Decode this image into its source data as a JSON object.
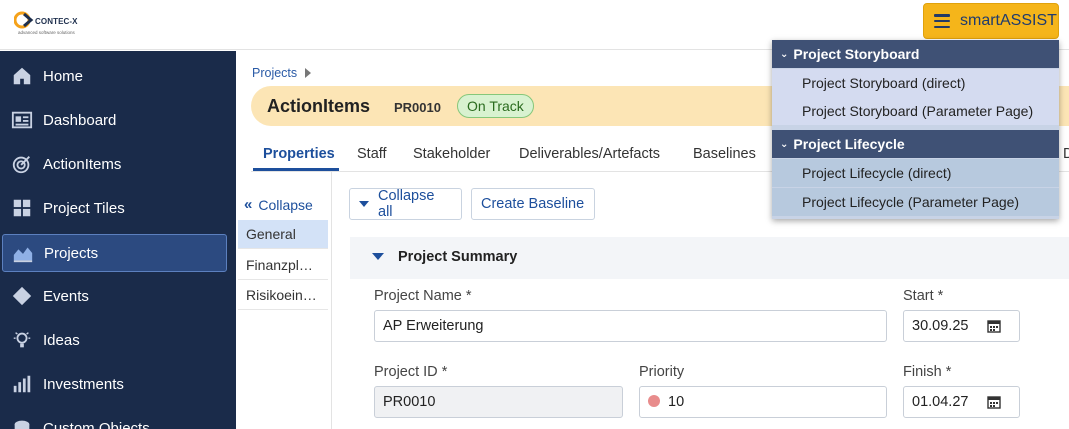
{
  "header": {
    "logo_text": "CONTEC-X",
    "logo_tagline": "advanced software solutions",
    "assistant_button": "smartASSIST"
  },
  "sidebar": {
    "items": [
      {
        "label": "Home",
        "icon": "home-icon"
      },
      {
        "label": "Dashboard",
        "icon": "dashboard-icon"
      },
      {
        "label": "ActionItems",
        "icon": "target-icon"
      },
      {
        "label": "Project Tiles",
        "icon": "tiles-icon"
      },
      {
        "label": "Projects",
        "icon": "chart-area-icon",
        "active": true
      },
      {
        "label": "Events",
        "icon": "diamond-icon"
      },
      {
        "label": "Ideas",
        "icon": "lightbulb-icon"
      },
      {
        "label": "Investments",
        "icon": "bar-chart-icon"
      },
      {
        "label": "Custom Objects",
        "icon": "custom-objects-icon"
      }
    ]
  },
  "breadcrumb": {
    "label": "Projects"
  },
  "project": {
    "title": "ActionItems",
    "code": "PR0010",
    "status": "On Track"
  },
  "tabs": [
    {
      "label": "Properties",
      "active": true
    },
    {
      "label": "Staff"
    },
    {
      "label": "Stakeholder"
    },
    {
      "label": "Deliverables/Artefacts"
    },
    {
      "label": "Baselines"
    },
    {
      "label": "D"
    }
  ],
  "subnav": {
    "collapse_label": "Collapse",
    "items": [
      {
        "label": "General",
        "active": true
      },
      {
        "label": "Finanzpl…"
      },
      {
        "label": "Risikoein…"
      }
    ]
  },
  "toolbar": {
    "collapse_all": "Collapse all",
    "create_baseline": "Create Baseline"
  },
  "section": {
    "title": "Project Summary",
    "fields": {
      "project_name": {
        "label": "Project Name",
        "required": "*",
        "value": "AP Erweiterung"
      },
      "start": {
        "label": "Start",
        "required": "*",
        "value": "30.09.25"
      },
      "project_id": {
        "label": "Project ID",
        "required": "*",
        "value": "PR0010"
      },
      "priority": {
        "label": "Priority",
        "value": "10"
      },
      "finish": {
        "label": "Finish",
        "required": "*",
        "value": "01.04.27"
      }
    }
  },
  "dropdown": {
    "groups": [
      {
        "title": "Project Storyboard",
        "items": [
          "Project Storyboard (direct)",
          "Project Storyboard (Parameter Page)"
        ]
      },
      {
        "title": "Project Lifecycle",
        "items": [
          "Project Lifecycle (direct)",
          "Project Lifecycle (Parameter Page)"
        ]
      }
    ]
  },
  "colors": {
    "sidebar_bg": "#1a2b4a",
    "accent": "#1d4f9c",
    "assistant_button": "#f5b51a",
    "title_band": "#fce5b5",
    "status_green": "#d8f2d0",
    "priority_dot": "#e88c8c"
  }
}
